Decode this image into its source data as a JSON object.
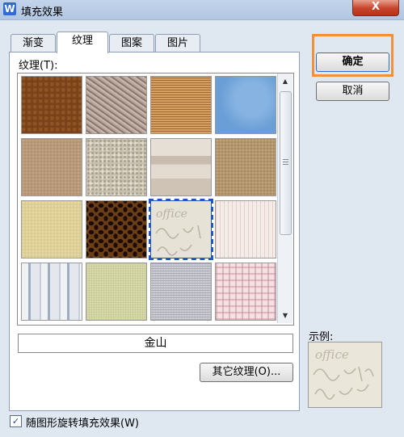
{
  "window": {
    "title": "填充效果",
    "app_icon_letter": "W",
    "close_label": "X"
  },
  "tabs": [
    {
      "label": "渐变",
      "active": false
    },
    {
      "label": "纹理",
      "active": true
    },
    {
      "label": "图案",
      "active": false
    },
    {
      "label": "图片",
      "active": false
    }
  ],
  "texture_section": {
    "label": "纹理(T):",
    "selected_name": "金山",
    "selected_index": 10,
    "more_button": "其它纹理(O)...",
    "sample_text": "office",
    "swatches": [
      {
        "name": "texture-brown-leather",
        "color": "#7a4218"
      },
      {
        "name": "texture-crumpled-paper",
        "color": "#a8938a"
      },
      {
        "name": "texture-woven-burlap",
        "color": "#c5884a"
      },
      {
        "name": "texture-blue-stone",
        "color": "#6a9ed6"
      },
      {
        "name": "texture-sand-paper",
        "color": "#b09272"
      },
      {
        "name": "texture-granite",
        "color": "#c8c1b0"
      },
      {
        "name": "texture-grey-stripes",
        "color": "#d8cfc4"
      },
      {
        "name": "texture-cork",
        "color": "#a88a62"
      },
      {
        "name": "texture-yellow-paper",
        "color": "#d8c98e"
      },
      {
        "name": "texture-leopard",
        "color": "#6b3e16"
      },
      {
        "name": "texture-kingsoft",
        "color": "#e7e2d6"
      },
      {
        "name": "texture-pink-lines",
        "color": "#efe6e2"
      },
      {
        "name": "texture-blue-stripes",
        "color": "#c9d3de"
      },
      {
        "name": "texture-green-mesh",
        "color": "#d9dcb0"
      },
      {
        "name": "texture-grey-weave",
        "color": "#c0c1c8"
      },
      {
        "name": "texture-pink-plaid",
        "color": "#e7c8cc"
      }
    ]
  },
  "buttons": {
    "ok": "确定",
    "cancel": "取消"
  },
  "preview": {
    "label": "示例:"
  },
  "options": {
    "rotate_with_shape": "随图形旋转填充效果(W)",
    "rotate_checked": "✓"
  }
}
